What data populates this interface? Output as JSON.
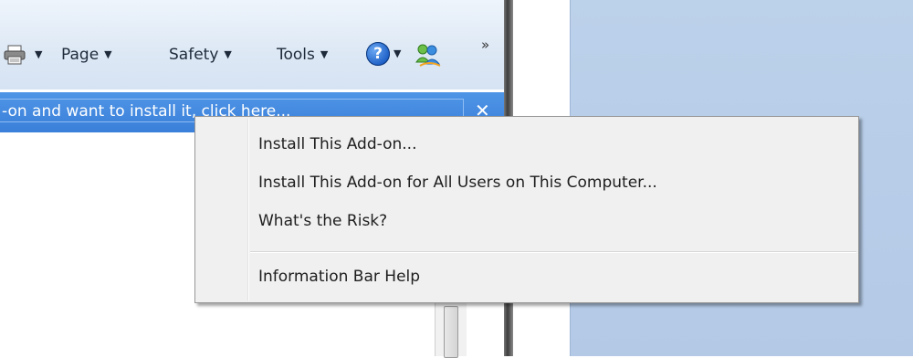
{
  "command_bar": {
    "items": [
      {
        "label": "Page"
      },
      {
        "label": "Safety"
      },
      {
        "label": "Tools"
      }
    ],
    "help_label": "?",
    "overflow_label": "»",
    "icons": [
      "printer-icon",
      "help-icon",
      "msn-icon"
    ]
  },
  "info_bar": {
    "text": "-on and want to install it, click here...",
    "close_label": "✕",
    "color": "#3a7fd9"
  },
  "context_menu": {
    "items": [
      {
        "label": "Install This Add-on..."
      },
      {
        "label": "Install This Add-on for All Users on This Computer..."
      },
      {
        "label": "What's the Risk?"
      },
      {
        "label": "Information Bar Help"
      }
    ]
  },
  "colors": {
    "desktop": "#b8cde8",
    "command_bar": "#dde8f5",
    "menu_background": "#f0f0f0"
  }
}
